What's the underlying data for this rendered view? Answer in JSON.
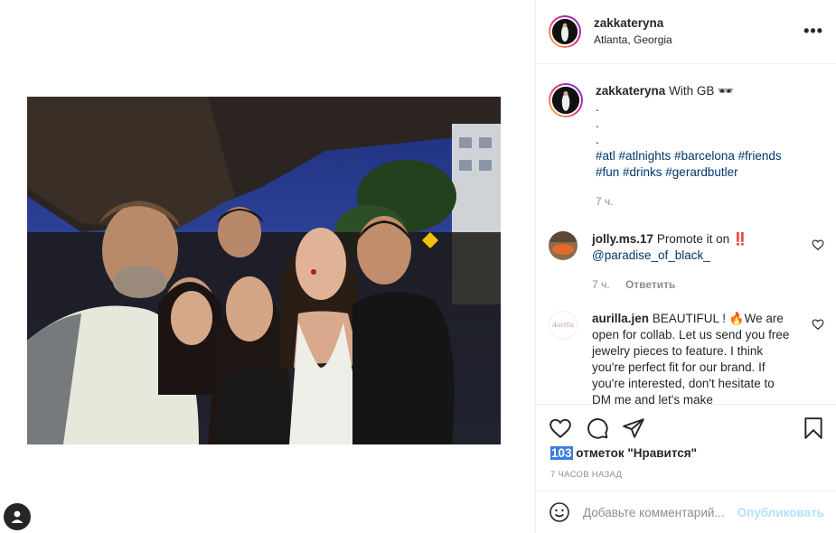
{
  "post": {
    "username": "zakkateryna",
    "location": "Atlanta, Georgia",
    "more_label": "•••",
    "caption": {
      "username": "zakkateryna",
      "text": "With GB 🕶",
      "dots": [
        ".",
        ".",
        "."
      ],
      "hashtags_line1": "#atl #atlnights #barcelona #friends",
      "hashtags_line2": "#fun #drinks #gerardbutler",
      "time": "7 ч."
    },
    "comments": [
      {
        "username": "jolly.ms.17",
        "text": "Promote it on ‼️",
        "mention": "@paradise_of_black_",
        "time": "7 ч.",
        "reply": "Ответить"
      },
      {
        "username": "aurilla.jen",
        "text": "BEAUTIFUL ! 🔥We are open for collab. Let us send you free jewelry pieces to feature. I think you're perfect fit for our brand. If you're interested, don't hesitate to DM me and let's make",
        "avatar_text": "Aurilla"
      }
    ],
    "likes": {
      "count": "103",
      "label": "отметок \"Нравится\""
    },
    "timestamp": "7 часов назад",
    "add_comment_placeholder": "Добавьте комментарий...",
    "publish_label": "Опубликовать"
  },
  "colors": {
    "link": "#00376b",
    "muted": "#8e8e8e",
    "publish": "#b2dffc",
    "like_highlight": "#3b7ddd"
  },
  "icons": [
    "more-icon",
    "heart-icon",
    "comment-icon",
    "share-icon",
    "bookmark-icon",
    "emoji-icon",
    "profile-icon"
  ]
}
